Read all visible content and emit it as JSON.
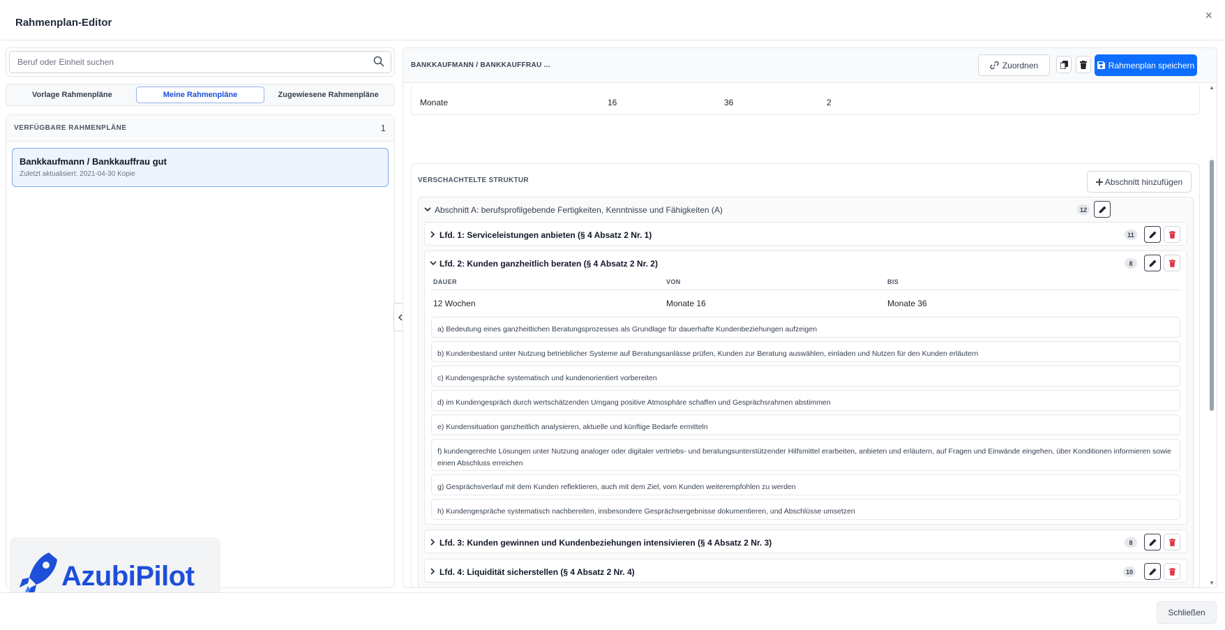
{
  "modal": {
    "title": "Rahmenplan-Editor",
    "close_glyph": "×",
    "footer_close": "Schließen"
  },
  "sidebar": {
    "search": {
      "placeholder": "Beruf oder Einheit suchen",
      "value": ""
    },
    "tabs": [
      {
        "label": "Vorlage Rahmenpläne",
        "active": false
      },
      {
        "label": "Meine Rahmenpläne",
        "active": true
      },
      {
        "label": "Zugewiesene Rahmenpläne",
        "active": false
      }
    ],
    "list_header": "VERFÜGBARE RAHMENPLÄNE",
    "list_count": "1",
    "plans": [
      {
        "title": "Bankkaufmann / Bankkauffrau gut",
        "subtitle": "Zuletzt aktualisiert: 2021-04-30 Kopie"
      }
    ]
  },
  "logo": {
    "text": "AzubiPilot",
    "color": "#1d4fd8"
  },
  "editor": {
    "title": "BANKKAUFMANN / BANKKAUFFRAU ...",
    "assign_label": "Zuordnen",
    "save_label": "Rahmenplan speichern",
    "months_row": [
      "Monate",
      "16",
      "36",
      "2"
    ],
    "structure_label": "VERSCHACHTELTE STRUKTUR",
    "add_section_label": "Abschnitt hinzufügen",
    "section": {
      "title": "Abschnitt A: berufsprofilgebende Fertigkeiten, Kenntnisse und Fähigkeiten (A)",
      "count": "12"
    },
    "lfd": [
      {
        "title": "Lfd. 1: Serviceleistungen anbieten (§ 4 Absatz 2 Nr. 1)",
        "count": "11",
        "expanded": false
      },
      {
        "title": "Lfd. 2: Kunden ganzheitlich beraten (§ 4 Absatz 2 Nr. 2)",
        "count": "8",
        "expanded": true,
        "headers": [
          "DAUER",
          "VON",
          "BIS"
        ],
        "values": [
          "12 Wochen",
          "Monate 16",
          "Monate 36"
        ],
        "items": [
          "a) Bedeutung eines ganzheitlichen Beratungsprozesses als Grundlage für dauerhafte Kundenbeziehungen aufzeigen",
          "b) Kundenbestand unter Nutzung betrieblicher Systeme auf Beratungsanlässe prüfen, Kunden zur Beratung auswählen, einladen und Nutzen für den Kunden erläutern",
          "c) Kundengespräche systematisch und kundenorientiert vorbereiten",
          "d) im Kundengespräch durch wertschätzenden Umgang positive Atmosphäre schaffen und Gesprächsrahmen abstimmen",
          "e) Kundensituation ganzheitlich analysieren, aktuelle und künftige Bedarfe ermitteln",
          "f) kundengerechte Lösungen unter Nutzung analoger oder digitaler vertriebs- und beratungsunterstützender Hilfsmittel erarbeiten, anbieten und erläutern, auf Fragen und Einwände eingehen, über Konditionen informieren sowie einen Abschluss erreichen",
          "g) Gesprächsverlauf mit dem Kunden reflektieren, auch mit dem Ziel, vom Kunden weiterempfohlen zu werden",
          "h) Kundengespräche systematisch nachbereiten, insbesondere Gesprächsergebnisse dokumentieren, und Abschlüsse umsetzen"
        ]
      },
      {
        "title": "Lfd. 3: Kunden gewinnen und Kundenbeziehungen intensivieren (§ 4 Absatz 2 Nr. 3)",
        "count": "8",
        "expanded": false
      },
      {
        "title": "Lfd. 4: Liquidität sicherstellen (§ 4 Absatz 2 Nr. 4)",
        "count": "10",
        "expanded": false
      }
    ]
  },
  "colors": {
    "primary": "#0d6efd",
    "danger": "#dc3545",
    "active_tab": "#1d4ed8"
  }
}
